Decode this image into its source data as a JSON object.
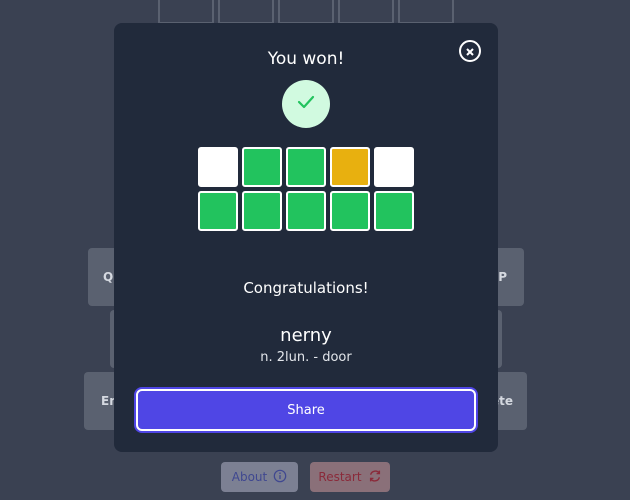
{
  "modal": {
    "title": "You won!",
    "congrats": "Congratulations!",
    "word": "nerny",
    "definition": "n. 2lun. - door",
    "share_label": "Share"
  },
  "grid": [
    [
      "absent",
      "correct",
      "correct",
      "present",
      "absent"
    ],
    [
      "correct",
      "correct",
      "correct",
      "correct",
      "correct"
    ]
  ],
  "keyboard_visible": {
    "q": "Q",
    "p": "P",
    "enter": "En",
    "delete": "ete"
  },
  "bottom": {
    "about_label": "About",
    "restart_label": "Restart"
  },
  "colors": {
    "correct": "#22c35e",
    "present": "#e8b00f",
    "absent": "#ffffff",
    "accent": "#4f46e5"
  }
}
